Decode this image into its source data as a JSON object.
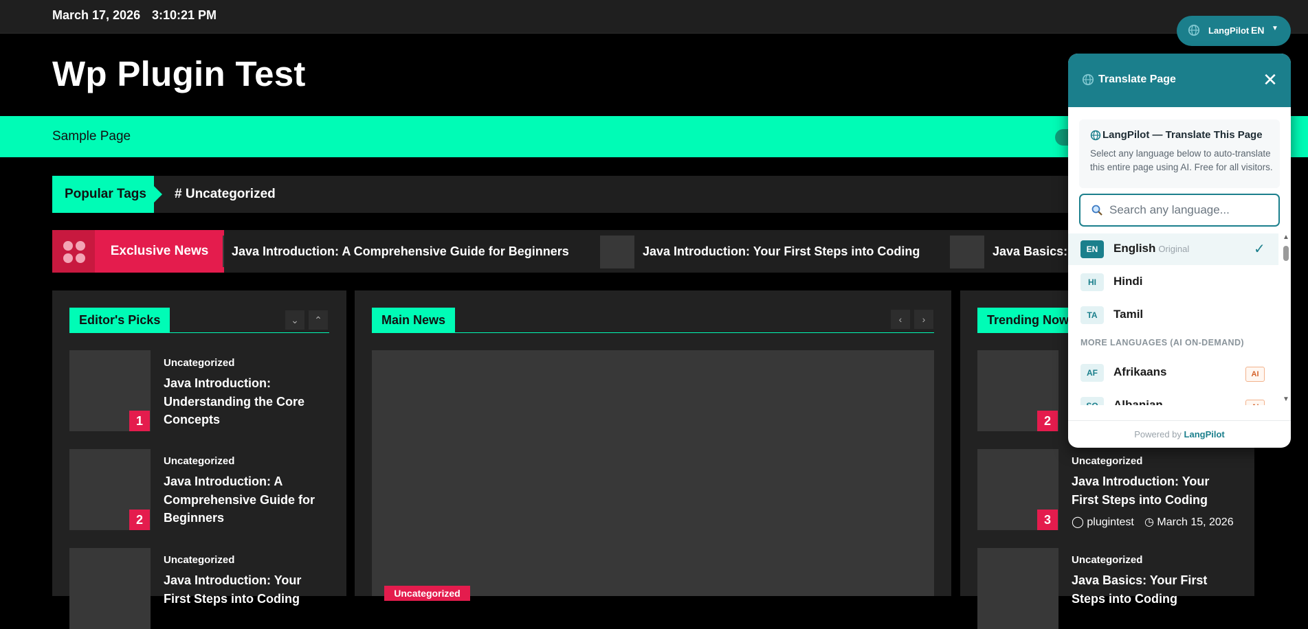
{
  "topbar": {
    "date": "March 17, 2026",
    "time": "3:10:21 PM"
  },
  "site": {
    "title": "Wp Plugin Test"
  },
  "nav": {
    "items": [
      "Sample Page"
    ]
  },
  "popular_tags": {
    "label": "Popular Tags",
    "tag": "# Uncategorized"
  },
  "exclusive": {
    "label": "Exclusive News",
    "items": [
      "Java Introduction: A Comprehensive Guide for Beginners",
      "Java Introduction: Your First Steps into Coding",
      "Java Basics: Y"
    ]
  },
  "editors_picks": {
    "title": "Editor's Picks",
    "items": [
      {
        "num": "1",
        "category": "Uncategorized",
        "title": "Java Introduction: Understanding the Core Concepts"
      },
      {
        "num": "2",
        "category": "Uncategorized",
        "title": "Java Introduction: A Comprehensive Guide for Beginners"
      },
      {
        "num": "",
        "category": "Uncategorized",
        "title": "Java Introduction: Your First Steps into Coding"
      }
    ]
  },
  "main_news": {
    "title": "Main News",
    "badge": "Uncategorized"
  },
  "trending": {
    "title": "Trending Now",
    "items": [
      {
        "num": "2",
        "category": "",
        "title": ""
      },
      {
        "num": "3",
        "category": "Uncategorized",
        "title": "Java Introduction: Your First Steps into Coding",
        "author": "plugintest",
        "date": "March 15, 2026"
      },
      {
        "num": "",
        "category": "Uncategorized",
        "title": "Java Basics: Your First Steps into Coding"
      }
    ]
  },
  "langpilot": {
    "button": {
      "name": "LangPilot",
      "code": "EN"
    },
    "panel": {
      "title": "Translate Page",
      "info_title": "LangPilot — Translate This Page",
      "info_desc": "Select any language below to auto-translate this entire page using AI. Free for all visitors.",
      "search_placeholder": "Search any language...",
      "original_label": "Original",
      "more_label": "MORE LANGUAGES (AI ON-DEMAND)",
      "ai_badge": "AI",
      "languages": [
        {
          "code": "EN",
          "name": "English",
          "selected": true
        },
        {
          "code": "HI",
          "name": "Hindi"
        },
        {
          "code": "TA",
          "name": "Tamil"
        }
      ],
      "more_languages": [
        {
          "code": "AF",
          "name": "Afrikaans"
        },
        {
          "code": "SQ",
          "name": "Albanian"
        }
      ],
      "footer_prefix": "Powered by",
      "footer_brand": "LangPilot"
    },
    "colors": {
      "brand": "#1b7f8c",
      "accent": "#00fcb6",
      "alert": "#e41c4d"
    }
  }
}
